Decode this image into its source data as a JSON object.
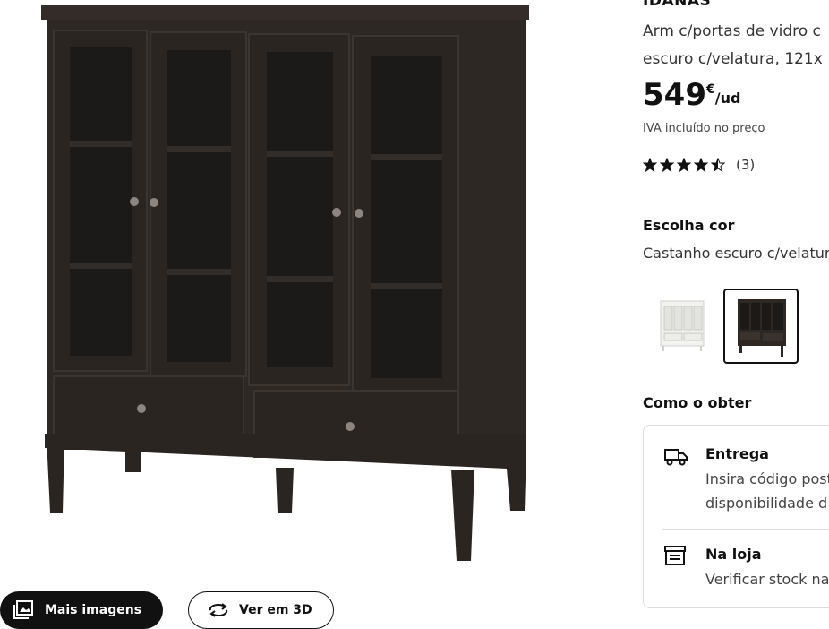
{
  "gallery": {
    "more_images_label": "Mais imagens",
    "view_3d_label": "Ver em 3D"
  },
  "product": {
    "name": "IDANÄS",
    "desc_line1": "Arm c/portas de vidro c",
    "desc_line2_prefix": "escuro c/velatura, ",
    "desc_size_link": "121x",
    "price_integer": "549",
    "price_currency": "€",
    "price_unit": "/ud",
    "vat_note": "IVA incluído no preço",
    "rating_value": 4.5,
    "rating_count": "(3)"
  },
  "color": {
    "heading": "Escolha cor",
    "selected_name": "Castanho escuro c/velatur",
    "options": [
      {
        "name": "white",
        "hex": "#f2f2f0",
        "selected": false
      },
      {
        "name": "dark-brown",
        "hex": "#2e2824",
        "selected": true
      }
    ]
  },
  "fulfillment": {
    "heading": "Como o obter",
    "delivery_title": "Entrega",
    "delivery_text_1": "Insira código post",
    "delivery_text_2": "disponibilidade d",
    "store_title": "Na loja",
    "store_text": "Verificar stock na"
  },
  "colors": {
    "wood": "#2e2824",
    "glass": "#1b1a19",
    "accent": "#111111"
  }
}
